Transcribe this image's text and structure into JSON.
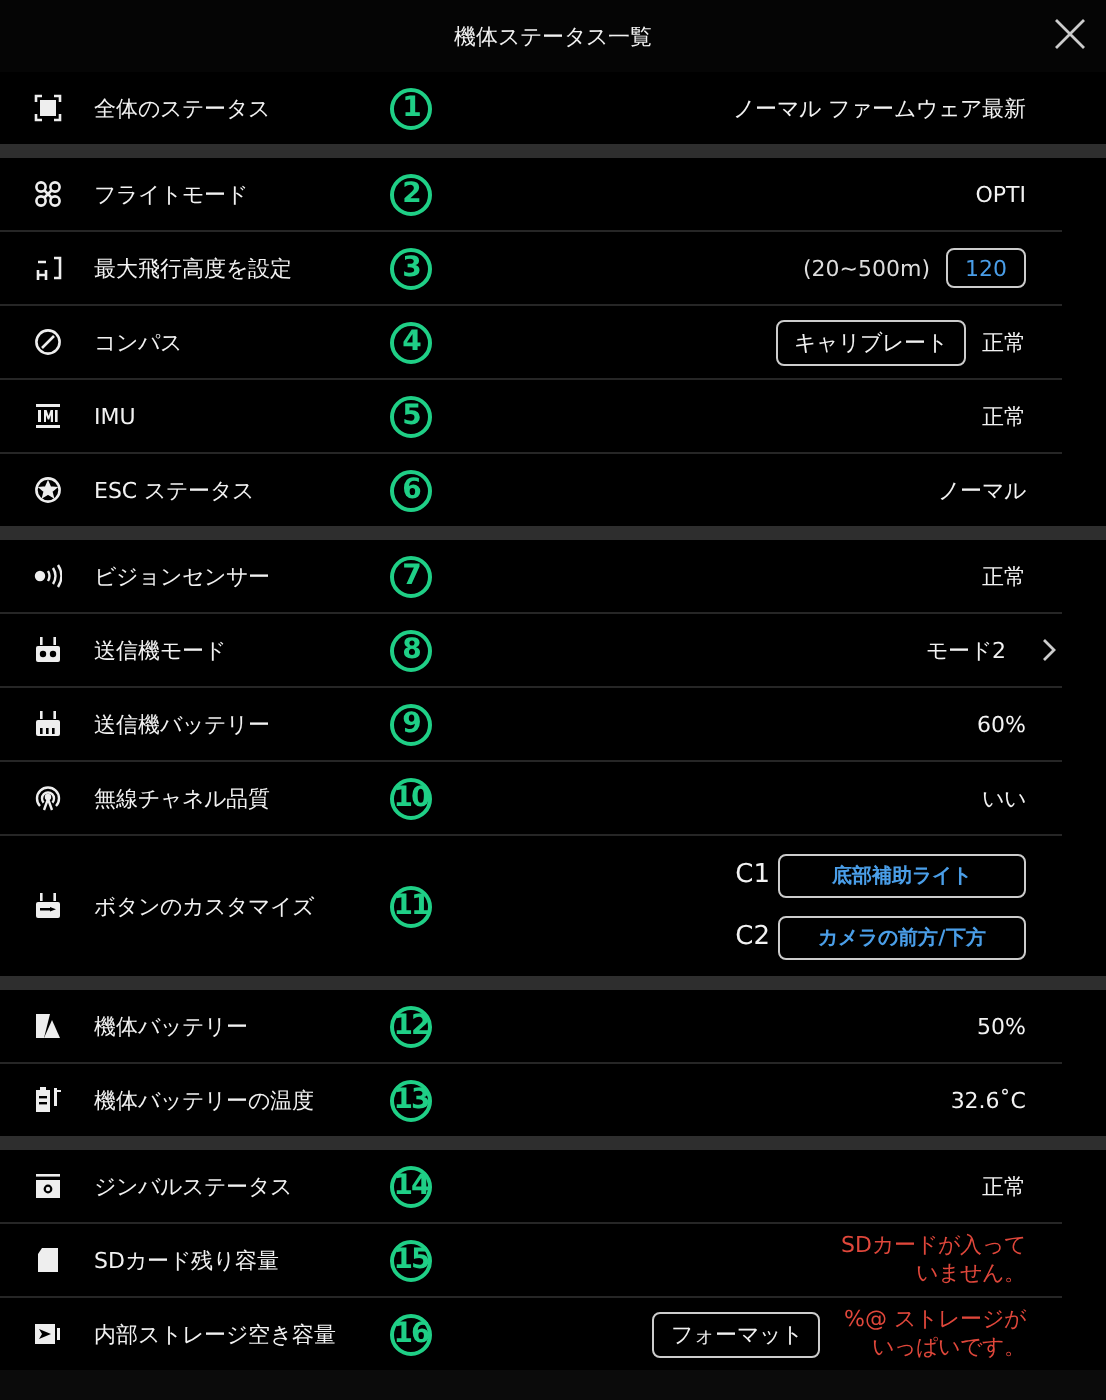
{
  "title": "機体ステータス一覧",
  "sections": [
    {
      "rows": [
        {
          "kind": "status",
          "label": "全体のステータス",
          "marker": "1",
          "value": "ノーマル ファームウェア最新"
        }
      ]
    },
    {
      "rows": [
        {
          "kind": "status",
          "label": "フライトモード",
          "marker": "2",
          "value": "OPTI"
        },
        {
          "kind": "range",
          "label": "最大飛行高度を設定",
          "marker": "3",
          "hint": "(20~500m)",
          "input": "120"
        },
        {
          "kind": "calibrate",
          "label": "コンパス",
          "marker": "4",
          "button": "キャリブレート",
          "value": "正常"
        },
        {
          "kind": "status",
          "label": "IMU",
          "marker": "5",
          "value": "正常"
        },
        {
          "kind": "status",
          "label": "ESC ステータス",
          "marker": "6",
          "value": "ノーマル"
        }
      ]
    },
    {
      "rows": [
        {
          "kind": "status",
          "label": "ビジョンセンサー",
          "marker": "7",
          "value": "正常"
        },
        {
          "kind": "link",
          "label": "送信機モード",
          "marker": "8",
          "value": "モード2"
        },
        {
          "kind": "status",
          "label": "送信機バッテリー",
          "marker": "9",
          "value": "60%"
        },
        {
          "kind": "status",
          "label": "無線チャネル品質",
          "marker": "10",
          "value": "いい"
        },
        {
          "kind": "assignments",
          "label": "ボタンのカスタマイズ",
          "marker": "11",
          "assignments": [
            {
              "key": "C1",
              "action": "底部補助ライト"
            },
            {
              "key": "C2",
              "action": "カメラの前方/下方"
            }
          ]
        }
      ]
    },
    {
      "rows": [
        {
          "kind": "status",
          "label": "機体バッテリー",
          "marker": "12",
          "value": "50%"
        },
        {
          "kind": "status",
          "label": "機体バッテリーの温度",
          "marker": "13",
          "value": "32.6˚C"
        }
      ]
    },
    {
      "rows": [
        {
          "kind": "status",
          "label": "ジンバルステータス",
          "marker": "14",
          "value": "正常"
        },
        {
          "kind": "warning",
          "label": "SDカード残り容量",
          "marker": "15",
          "value": "SDカードが入っていません。"
        },
        {
          "kind": "format",
          "label": "内部ストレージ空き容量",
          "marker": "16",
          "button": "フォーマット",
          "value": "%@ ストレージがいっぱいです。"
        }
      ]
    }
  ]
}
